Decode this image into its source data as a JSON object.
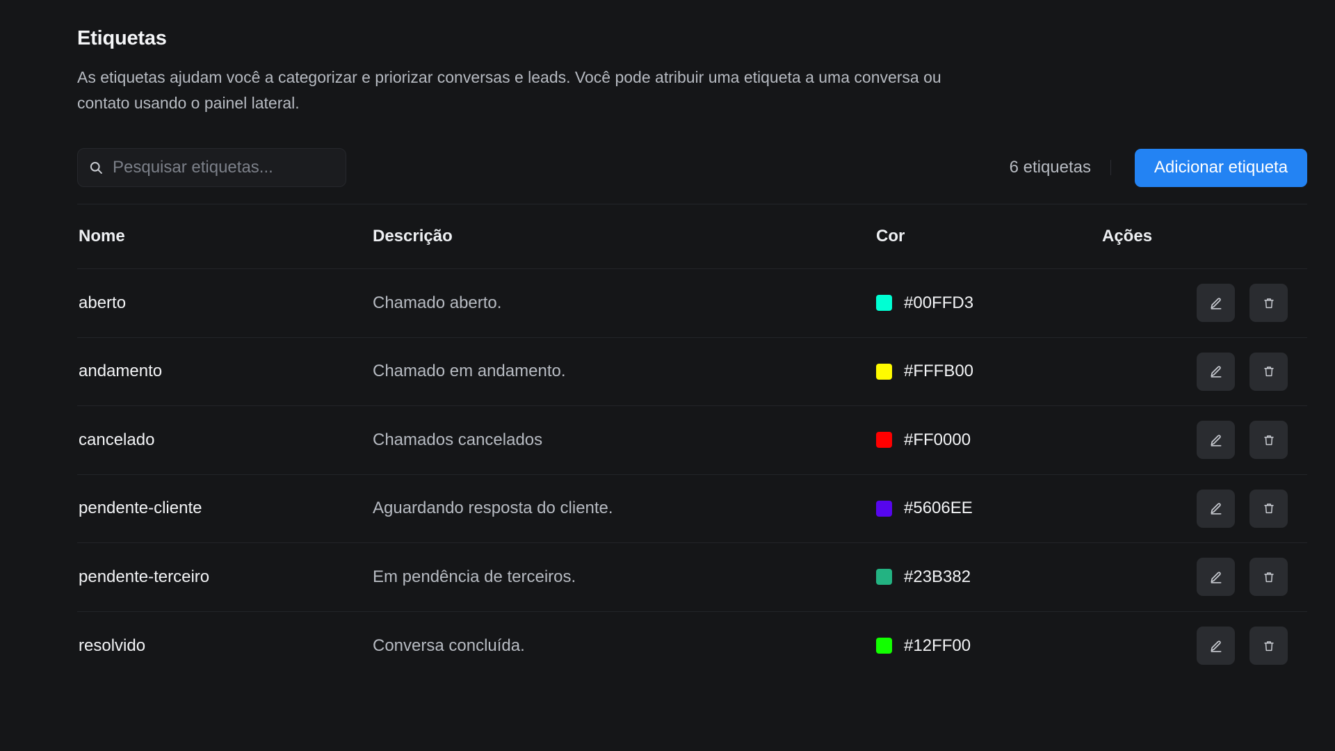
{
  "page": {
    "title": "Etiquetas",
    "description": "As etiquetas ajudam você a categorizar e priorizar conversas e leads. Você pode atribuir uma etiqueta a uma conversa ou contato usando o painel lateral."
  },
  "toolbar": {
    "search_placeholder": "Pesquisar etiquetas...",
    "count_label": "6 etiquetas",
    "add_label": "Adicionar etiqueta",
    "search_icon": "search-icon"
  },
  "table": {
    "headers": {
      "name": "Nome",
      "description": "Descrição",
      "color": "Cor",
      "actions": "Ações"
    },
    "rows": [
      {
        "name": "aberto",
        "description": "Chamado aberto.",
        "color": "#00FFD3"
      },
      {
        "name": "andamento",
        "description": "Chamado em andamento.",
        "color": "#FFFB00"
      },
      {
        "name": "cancelado",
        "description": "Chamados cancelados",
        "color": "#FF0000"
      },
      {
        "name": "pendente-cliente",
        "description": "Aguardando resposta do cliente.",
        "color": "#5606EE"
      },
      {
        "name": "pendente-terceiro",
        "description": "Em pendência de terceiros.",
        "color": "#23B382"
      },
      {
        "name": "resolvido",
        "description": "Conversa concluída.",
        "color": "#12FF00"
      }
    ],
    "row_action_icons": [
      "edit-icon",
      "trash-icon"
    ]
  },
  "colors": {
    "background": "#151618",
    "accent": "#2383F3"
  }
}
